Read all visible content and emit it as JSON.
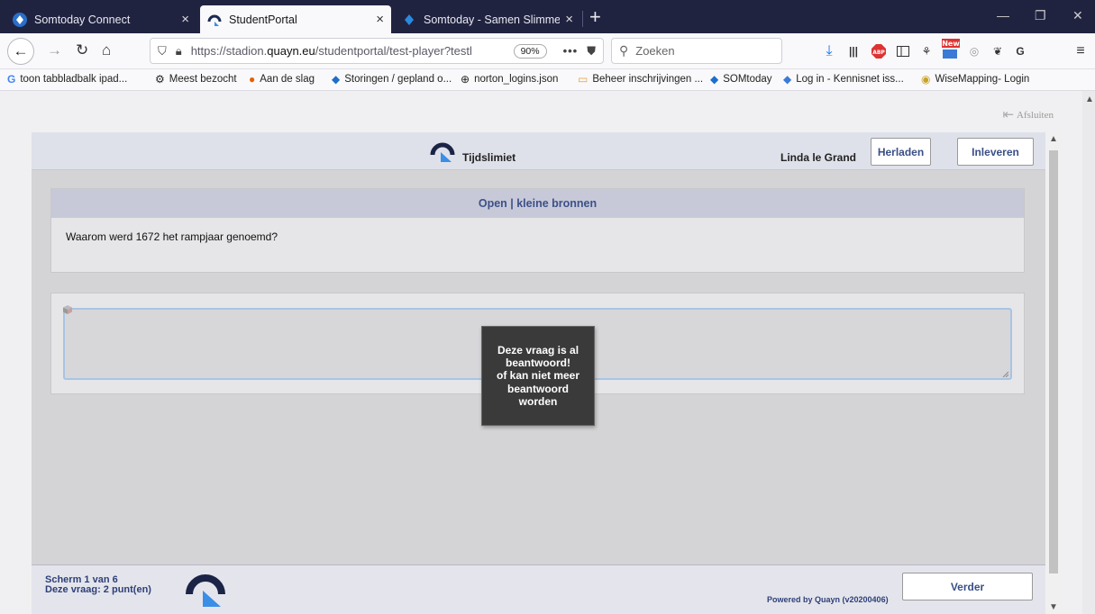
{
  "browser": {
    "tabs": [
      {
        "title": "Somtoday Connect",
        "close": "×"
      },
      {
        "title": "StudentPortal",
        "close": "×"
      },
      {
        "title": "Somtoday - Samen Slimmer On",
        "close": "×"
      }
    ],
    "new_tab": "+",
    "window_controls": {
      "minimize": "—",
      "restore": "❐",
      "close": "✕"
    },
    "nav": {
      "back": "←",
      "forward": "→",
      "reload": "↻",
      "home": "⌂"
    },
    "url_prefix": "https://stadion.",
    "url_domain": "quayn.eu",
    "url_rest": "/studentportal/test-player?testl",
    "zoom": "90%",
    "page_actions": "•••",
    "search_placeholder": "Zoeken",
    "toolbar_icons": [
      "download-icon",
      "library-icon",
      "adblock-icon",
      "sidebar-icon",
      "tracker-icon",
      "extension-new-icon",
      "extension-icon",
      "ghost-icon",
      "extension-g-icon",
      "menu-icon"
    ],
    "extension_badge": "New"
  },
  "bookmarks": [
    {
      "label": "toon tabbladbalk ipad...",
      "icon": "G"
    },
    {
      "label": "Meest bezocht",
      "icon": "⚙"
    },
    {
      "label": "Aan de slag",
      "icon": "●"
    },
    {
      "label": "Storingen / gepland o...",
      "icon": "◆"
    },
    {
      "label": "norton_logins.json",
      "icon": "⊕"
    },
    {
      "label": "Beheer inschrijvingen ...",
      "icon": "▭"
    },
    {
      "label": "SOMtoday",
      "icon": "◆"
    },
    {
      "label": "Log in - Kennisnet iss...",
      "icon": "◆"
    },
    {
      "label": "WiseMapping- Login",
      "icon": "◉"
    }
  ],
  "page": {
    "exit_label": "Afsluiten",
    "timer_label": "Tijdslimiet",
    "student_name": "Linda le Grand",
    "reload_button": "Herladen",
    "submit_button": "Inleveren",
    "question_type": "Open | kleine bronnen",
    "question_text": "Waarom werd 1672 het rampjaar genoemd?",
    "answer_value": "",
    "tooltip_lines": [
      "Deze vraag is al",
      "beantwoord!",
      "of kan niet meer",
      "beantwoord",
      "worden"
    ],
    "screen_count": "Scherm 1 van 6",
    "points": "Deze vraag: 2 punt(en)",
    "powered_by": "Powered by Quayn (v20200406)",
    "next_button": "Verder"
  },
  "colors": {
    "tabstrip": "#202340",
    "accent_text": "#3a4f86",
    "header_bar": "#dfe1ea",
    "question_type_bar": "#c7c9d9",
    "tooltip_bg": "#3a3a3a"
  }
}
